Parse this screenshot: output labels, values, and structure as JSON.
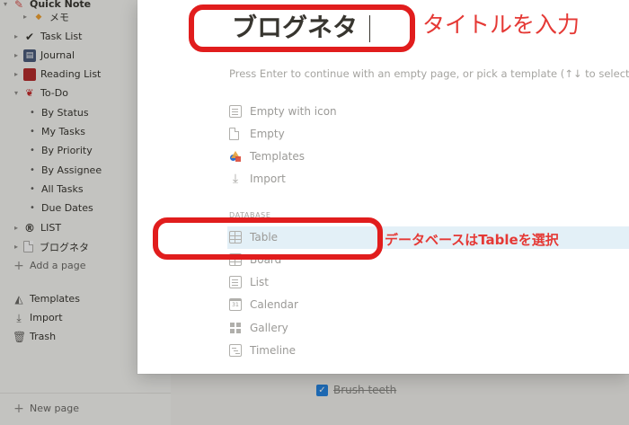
{
  "sidebar": {
    "items": [
      {
        "label": "Quick Note",
        "icon": "pin-icon",
        "glyph": "📌"
      },
      {
        "label": "メモ",
        "icon": "diamond-icon",
        "glyph": "◆"
      },
      {
        "label": "Task List",
        "icon": "check-icon",
        "glyph": "✔"
      },
      {
        "label": "Journal",
        "icon": "journal-icon",
        "glyph": "▤"
      },
      {
        "label": "Reading List",
        "icon": "book-icon",
        "glyph": "■"
      },
      {
        "label": "To-Do",
        "icon": "bow-icon",
        "glyph": "🎀"
      },
      {
        "label": "LIST",
        "icon": "registered-icon",
        "glyph": "®"
      },
      {
        "label": "ブログネタ",
        "icon": "page-icon",
        "glyph": "🗋"
      }
    ],
    "views": [
      "By Status",
      "My Tasks",
      "By Priority",
      "By Assignee",
      "All Tasks",
      "Due Dates"
    ],
    "add_page": "Add a page",
    "templates": "Templates",
    "import": "Import",
    "trash": "Trash",
    "new_page": "New page"
  },
  "page": {
    "todo_item": "Brush teeth"
  },
  "modal": {
    "title": "ブログネタ",
    "hint": "Press Enter to continue with an empty page, or pick a template (↑↓ to select)",
    "options": [
      "Empty with icon",
      "Empty",
      "Templates",
      "Import"
    ],
    "database_label": "DATABASE",
    "database_options": [
      "Table",
      "Board",
      "List",
      "Calendar",
      "Gallery",
      "Timeline"
    ]
  },
  "annotations": {
    "title_note": "タイトルを入力",
    "table_note": "データベースはTableを選択",
    "color": "#e53935"
  }
}
